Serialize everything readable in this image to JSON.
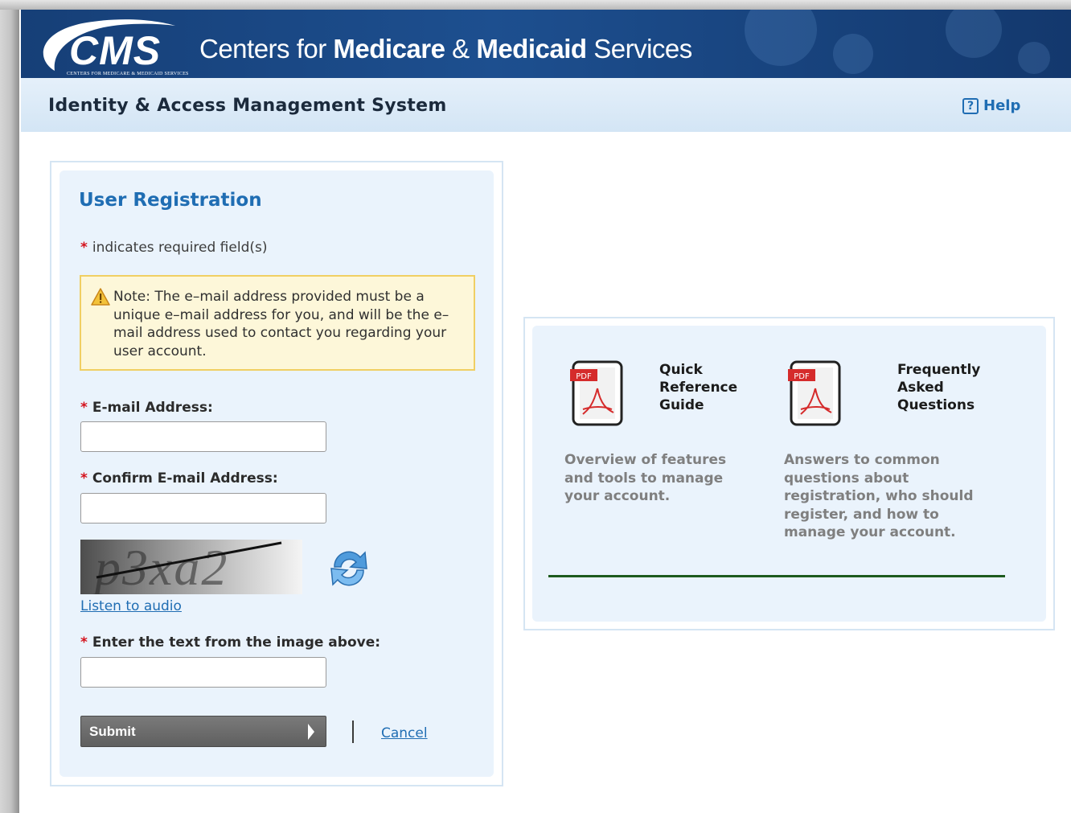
{
  "header": {
    "logo_text": "CMS",
    "logo_subtext": "CENTERS FOR MEDICARE & MEDICAID SERVICES",
    "agency_part1": "Centers for ",
    "agency_part2": "Medicare",
    "agency_part3": " & ",
    "agency_part4": "Medicaid",
    "agency_part5": " Services",
    "system_title": "Identity & Access Management System",
    "help_label": "Help",
    "colors": {
      "header_blue": "#1d4f8f",
      "link_blue": "#1f6db3"
    }
  },
  "registration": {
    "title": "User Registration",
    "required_star": "*",
    "required_note": "indicates required field(s)",
    "note": "Note: The e–mail address provided must be a unique e–mail address for you, and will be the e–mail address used to contact you regarding your user account.",
    "email_label": "E-mail Address:",
    "email_value": "",
    "confirm_email_label": "Confirm E-mail Address:",
    "confirm_email_value": "",
    "captcha_text": "p3xa2",
    "audio_link": "Listen to audio",
    "captcha_label": "Enter the text from the image above:",
    "captcha_value": "",
    "submit_label": "Submit",
    "cancel_label": "Cancel",
    "icons": [
      "warning-icon",
      "refresh-icon",
      "help-icon"
    ]
  },
  "resources": {
    "items": [
      {
        "icon": "pdf-icon",
        "icon_badge": "PDF",
        "title": "Quick Reference Guide",
        "description": "Overview of features and tools to manage your account."
      },
      {
        "icon": "pdf-icon",
        "icon_badge": "PDF",
        "title": "Frequently Asked Questions",
        "description": "Answers to common questions about registration, who should register, and how to manage your account."
      }
    ]
  }
}
